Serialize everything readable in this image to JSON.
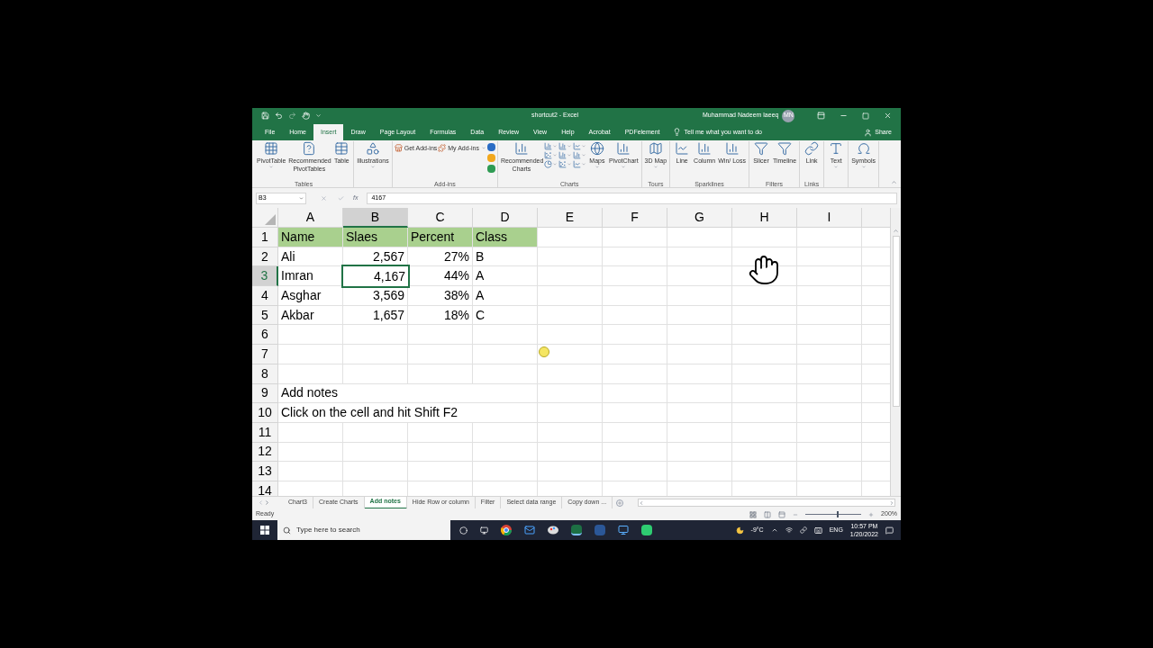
{
  "title_bar": {
    "title": "shortcut2 - Excel",
    "user": "Muhammad Nadeem laeeq",
    "avatar": "MN"
  },
  "menu_tabs": [
    {
      "label": "File",
      "selected": false
    },
    {
      "label": "Home",
      "selected": false
    },
    {
      "label": "Insert",
      "selected": true
    },
    {
      "label": "Draw",
      "selected": false
    },
    {
      "label": "Page Layout",
      "selected": false
    },
    {
      "label": "Formulas",
      "selected": false
    },
    {
      "label": "Data",
      "selected": false
    },
    {
      "label": "Review",
      "selected": false
    },
    {
      "label": "View",
      "selected": false
    },
    {
      "label": "Help",
      "selected": false
    },
    {
      "label": "Acrobat",
      "selected": false
    },
    {
      "label": "PDFelement",
      "selected": false
    }
  ],
  "tell_me": "Tell me what you want to do",
  "share": "Share",
  "ribbon_groups": [
    {
      "label": "Tables",
      "items": [
        {
          "kind": "large",
          "label": "PivotTable",
          "caret": true
        },
        {
          "kind": "large",
          "label": "Recommended PivotTables",
          "caret": false
        },
        {
          "kind": "large",
          "label": "Table",
          "caret": false
        }
      ]
    },
    {
      "items": [
        {
          "kind": "large",
          "label": "Illustrations",
          "caret": true
        }
      ]
    },
    {
      "label": "Add-ins",
      "items": [
        {
          "kind": "small",
          "label": "Get Add-ins",
          "caret": false
        },
        {
          "kind": "small",
          "label": "My Add-ins",
          "caret": true
        },
        {
          "kind": "app_icons"
        }
      ]
    },
    {
      "label": "Charts",
      "items": [
        {
          "kind": "large",
          "label": "Recommended Charts",
          "caret": false
        },
        {
          "kind": "chart_grid"
        },
        {
          "kind": "large",
          "label": "Maps",
          "caret": true
        },
        {
          "kind": "large",
          "label": "PivotChart",
          "caret": true
        }
      ]
    },
    {
      "label": "Tours",
      "items": [
        {
          "kind": "large",
          "label": "3D Map",
          "caret": true
        }
      ]
    },
    {
      "label": "Sparklines",
      "items": [
        {
          "kind": "large",
          "label": "Line",
          "caret": false
        },
        {
          "kind": "large",
          "label": "Column",
          "caret": false
        },
        {
          "kind": "large",
          "label": "Win/ Loss",
          "caret": false
        }
      ]
    },
    {
      "label": "Filters",
      "items": [
        {
          "kind": "large",
          "label": "Slicer",
          "caret": false
        },
        {
          "kind": "large",
          "label": "Timeline",
          "caret": false
        }
      ]
    },
    {
      "label": "Links",
      "items": [
        {
          "kind": "large",
          "label": "Link",
          "caret": false
        }
      ]
    },
    {
      "items": [
        {
          "kind": "large",
          "label": "Text",
          "caret": true
        }
      ]
    },
    {
      "items": [
        {
          "kind": "large",
          "label": "Symbols",
          "caret": true
        }
      ]
    }
  ],
  "formula_bar": {
    "name_box": "B3",
    "fx": "fx",
    "formula": "4167"
  },
  "columns": [
    {
      "label": "A",
      "selected": false
    },
    {
      "label": "B",
      "selected": true
    },
    {
      "label": "C",
      "selected": false
    },
    {
      "label": "D",
      "selected": false
    },
    {
      "label": "E",
      "selected": false
    },
    {
      "label": "F",
      "selected": false
    },
    {
      "label": "G",
      "selected": false
    },
    {
      "label": "H",
      "selected": false
    },
    {
      "label": "I",
      "selected": false
    }
  ],
  "rows": [
    {
      "header": "1",
      "selected": false,
      "cells": [
        {
          "kind": "text",
          "text": "Name",
          "fill": true,
          "selected": false
        },
        {
          "kind": "text",
          "text": "Slaes",
          "fill": true,
          "selected": false
        },
        {
          "kind": "text",
          "text": "Percent",
          "fill": true,
          "selected": false
        },
        {
          "kind": "text",
          "text": "Class",
          "fill": true,
          "selected": false
        }
      ]
    },
    {
      "header": "2",
      "selected": false,
      "cells": [
        {
          "kind": "text",
          "text": "Ali",
          "fill": false,
          "selected": false
        },
        {
          "kind": "number",
          "text": "2,567",
          "fill": false,
          "selected": false
        },
        {
          "kind": "number",
          "text": "27%",
          "fill": false,
          "selected": false
        },
        {
          "kind": "text",
          "text": "B",
          "fill": false,
          "selected": false
        }
      ]
    },
    {
      "header": "3",
      "selected": true,
      "cells": [
        {
          "kind": "text",
          "text": "Imran",
          "fill": false,
          "selected": false
        },
        {
          "kind": "number",
          "text": "4,167",
          "fill": false,
          "selected": true
        },
        {
          "kind": "number",
          "text": "44%",
          "fill": false,
          "selected": false
        },
        {
          "kind": "text",
          "text": "A",
          "fill": false,
          "selected": false
        }
      ]
    },
    {
      "header": "4",
      "selected": false,
      "cells": [
        {
          "kind": "text",
          "text": "Asghar",
          "fill": false,
          "selected": false
        },
        {
          "kind": "number",
          "text": "3,569",
          "fill": false,
          "selected": false
        },
        {
          "kind": "number",
          "text": "38%",
          "fill": false,
          "selected": false
        },
        {
          "kind": "text",
          "text": "A",
          "fill": false,
          "selected": false
        }
      ]
    },
    {
      "header": "5",
      "selected": false,
      "cells": [
        {
          "kind": "text",
          "text": "Akbar",
          "fill": false,
          "selected": false
        },
        {
          "kind": "number",
          "text": "1,657",
          "fill": false,
          "selected": false
        },
        {
          "kind": "number",
          "text": "18%",
          "fill": false,
          "selected": false
        },
        {
          "kind": "text",
          "text": "C",
          "fill": false,
          "selected": false
        }
      ]
    },
    {
      "header": "6",
      "selected": false,
      "cells": []
    },
    {
      "header": "7",
      "selected": false,
      "cells": []
    },
    {
      "header": "8",
      "selected": false,
      "cells": []
    },
    {
      "header": "9",
      "selected": false,
      "cells": [
        {
          "kind": "text",
          "text": "Add notes",
          "fill": false,
          "selected": false
        }
      ]
    },
    {
      "header": "10",
      "selected": false,
      "cells": [
        {
          "kind": "text",
          "text": "Click on the cell and hit Shift F2",
          "fill": false,
          "selected": false
        }
      ]
    },
    {
      "header": "11",
      "selected": false,
      "cells": []
    },
    {
      "header": "12",
      "selected": false,
      "cells": []
    },
    {
      "header": "13",
      "selected": false,
      "cells": []
    },
    {
      "header": "14",
      "selected": false,
      "cells": []
    }
  ],
  "sheet_tabs": [
    {
      "label": "Chart3",
      "selected": false
    },
    {
      "label": "Create Charts",
      "selected": false
    },
    {
      "label": "Add notes",
      "selected": true
    },
    {
      "label": "Hide Row or column",
      "selected": false
    },
    {
      "label": "Filter",
      "selected": false
    },
    {
      "label": "Select data range",
      "selected": false
    },
    {
      "label": "Copy down ...",
      "selected": false
    }
  ],
  "status_bar": {
    "status": "Ready",
    "zoom": "200%",
    "zoom_slider": {
      "level": 0.56
    }
  },
  "taskbar": {
    "search_placeholder": "Type here to search",
    "temperature": "-9°C",
    "language": "ENG",
    "time": "10:57 PM",
    "date": "1/20/2022"
  }
}
